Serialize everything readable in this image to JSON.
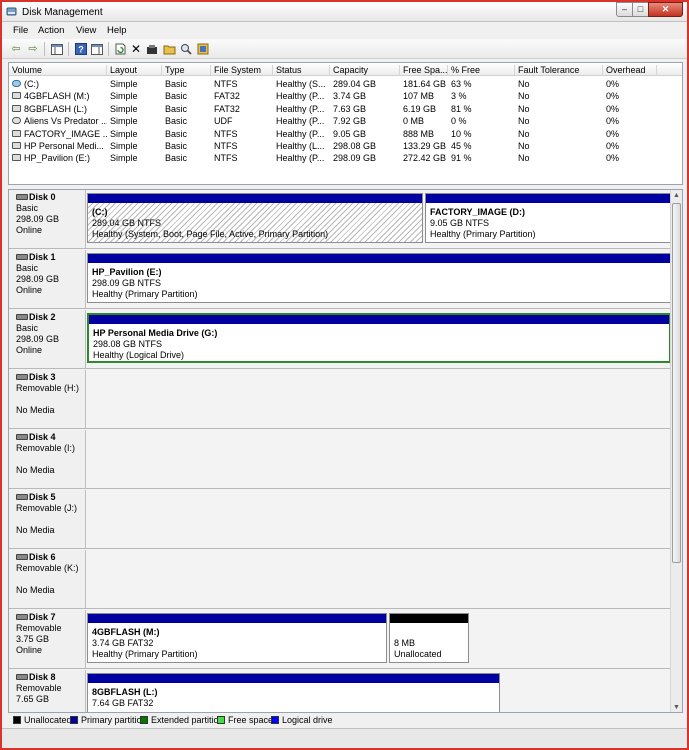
{
  "window": {
    "title": "Disk Management",
    "buttons": {
      "minimize": "–",
      "maximize": "□",
      "close": "✕"
    }
  },
  "menu": {
    "items": [
      "File",
      "Action",
      "View",
      "Help"
    ]
  },
  "toolbar": {
    "icons": [
      "back-arrow-icon",
      "forward-arrow-icon",
      "show-hide-tree-icon",
      "help-icon",
      "console-icon",
      "refresh-icon",
      "delete-icon",
      "properties-icon",
      "open-folder-icon",
      "explore-icon",
      "settings-icon"
    ]
  },
  "volumes": {
    "columns": [
      "Volume",
      "Layout",
      "Type",
      "File System",
      "Status",
      "Capacity",
      "Free Spa...",
      "% Free",
      "Fault Tolerance",
      "Overhead"
    ],
    "rows": [
      {
        "icon": "disk",
        "cells": [
          "(C:)",
          "Simple",
          "Basic",
          "NTFS",
          "Healthy (S...",
          "289.04 GB",
          "181.64 GB",
          "63 %",
          "No",
          "0%"
        ]
      },
      {
        "icon": "usb",
        "cells": [
          "4GBFLASH (M:)",
          "Simple",
          "Basic",
          "FAT32",
          "Healthy (P...",
          "3.74 GB",
          "107 MB",
          "3 %",
          "No",
          "0%"
        ]
      },
      {
        "icon": "usb",
        "cells": [
          "8GBFLASH (L:)",
          "Simple",
          "Basic",
          "FAT32",
          "Healthy (P...",
          "7.63 GB",
          "6.19 GB",
          "81 %",
          "No",
          "0%"
        ]
      },
      {
        "icon": "cd",
        "cells": [
          "Aliens Vs Predator ...",
          "Simple",
          "Basic",
          "UDF",
          "Healthy (P...",
          "7.92 GB",
          "0 MB",
          "0 %",
          "No",
          "0%"
        ]
      },
      {
        "icon": "drive",
        "cells": [
          "FACTORY_IMAGE ...",
          "Simple",
          "Basic",
          "NTFS",
          "Healthy (P...",
          "9.05 GB",
          "888 MB",
          "10 %",
          "No",
          "0%"
        ]
      },
      {
        "icon": "drive",
        "cells": [
          "HP Personal Medi...",
          "Simple",
          "Basic",
          "NTFS",
          "Healthy (L...",
          "298.08 GB",
          "133.29 GB",
          "45 %",
          "No",
          "0%"
        ]
      },
      {
        "icon": "drive",
        "cells": [
          "HP_Pavilion (E:)",
          "Simple",
          "Basic",
          "NTFS",
          "Healthy (P...",
          "298.09 GB",
          "272.42 GB",
          "91 %",
          "No",
          "0%"
        ]
      }
    ]
  },
  "disks": [
    {
      "name": "Disk 0",
      "lines": [
        "Basic",
        "298.09 GB",
        "Online"
      ],
      "parts": [
        {
          "name": "(C:)",
          "size": "289.04 GB NTFS",
          "status": "Healthy (System, Boot, Page File, Active, Primary Partition)",
          "hatched": true
        },
        {
          "name": "FACTORY_IMAGE  (D:)",
          "size": "9.05 GB NTFS",
          "status": "Healthy (Primary Partition)"
        }
      ]
    },
    {
      "name": "Disk 1",
      "lines": [
        "Basic",
        "298.09 GB",
        "Online"
      ],
      "parts": [
        {
          "name": "HP_Pavilion  (E:)",
          "size": "298.09 GB NTFS",
          "status": "Healthy (Primary Partition)"
        }
      ]
    },
    {
      "name": "Disk 2",
      "lines": [
        "Basic",
        "298.09 GB",
        "Online"
      ],
      "parts": [
        {
          "name": "HP Personal Media Drive  (G:)",
          "size": "298.08 GB NTFS",
          "status": "Healthy (Logical Drive)"
        }
      ]
    },
    {
      "name": "Disk 3",
      "lines": [
        "Removable (H:)",
        "",
        "No Media"
      ]
    },
    {
      "name": "Disk 4",
      "lines": [
        "Removable (I:)",
        "",
        "No Media"
      ]
    },
    {
      "name": "Disk 5",
      "lines": [
        "Removable (J:)",
        "",
        "No Media"
      ]
    },
    {
      "name": "Disk 6",
      "lines": [
        "Removable (K:)",
        "",
        "No Media"
      ]
    },
    {
      "name": "Disk 7",
      "lines": [
        "Removable",
        "3.75 GB",
        "Online"
      ],
      "parts": [
        {
          "name": "4GBFLASH  (M:)",
          "size": "3.74 GB FAT32",
          "status": "Healthy (Primary Partition)"
        },
        {
          "name": "",
          "size": "8 MB",
          "status": "Unallocated",
          "unallocated": true
        }
      ]
    },
    {
      "name": "Disk 8",
      "lines": [
        "Removable",
        "7.65 GB",
        ""
      ],
      "parts": [
        {
          "name": "8GBFLASH  (L:)",
          "size": "7.64 GB FAT32",
          "status": ""
        }
      ]
    }
  ],
  "legend": [
    {
      "label": "Unallocated",
      "color": "#000000"
    },
    {
      "label": "Primary partition",
      "color": "#0000a0"
    },
    {
      "label": "Extended partition",
      "color": "#007a00"
    },
    {
      "label": "Free space",
      "color": "#40e040"
    },
    {
      "label": "Logical drive",
      "color": "#0000ff"
    }
  ]
}
